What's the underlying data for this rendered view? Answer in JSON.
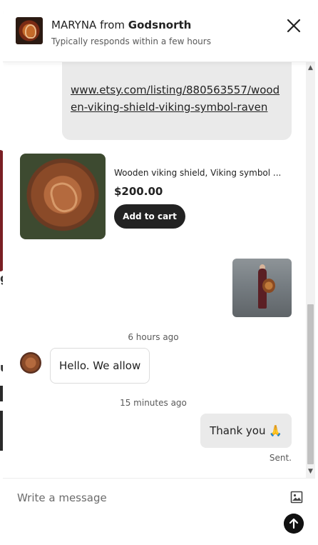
{
  "header": {
    "shop_person": "MARYNA",
    "from_word": "from",
    "shop_name": "Godsnorth",
    "response_time": "Typically responds within a few hours"
  },
  "messages": {
    "link_url": "www.etsy.com/listing/880563557/wooden-viking-shield-viking-symbol-raven",
    "listing": {
      "title": "Wooden viking shield, Viking symbol ...",
      "price": "$200.00",
      "cart_label": "Add to cart"
    },
    "time_1": "6 hours ago",
    "incoming_text": "Hello. We allow",
    "time_2": "15 minutes ago",
    "outgoing_text": "Thank you 🙏",
    "status": "Sent."
  },
  "composer": {
    "placeholder": "Write a message"
  },
  "icons": [
    "close-icon",
    "image-icon",
    "send-arrow-icon",
    "scroll-up-icon",
    "scroll-down-icon"
  ],
  "colors": {
    "bubble_gray": "#eaeaea",
    "button_dark": "#222222",
    "text_muted": "#595959"
  }
}
